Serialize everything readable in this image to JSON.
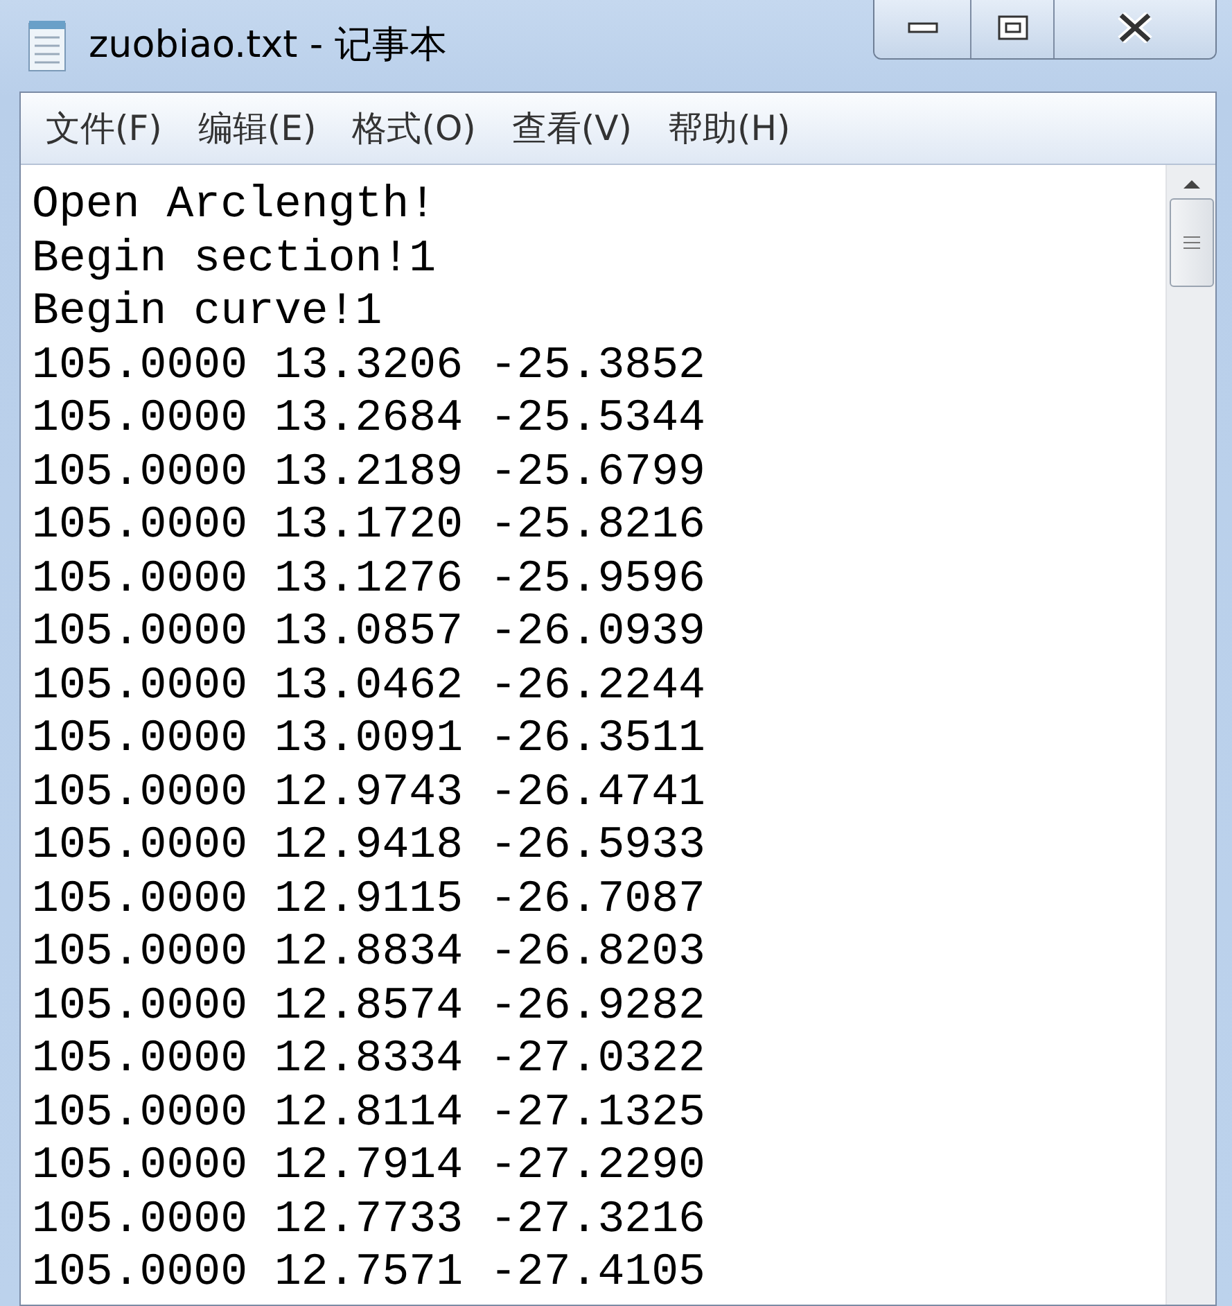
{
  "window": {
    "title": "zuobiao.txt - 记事本"
  },
  "menu": [
    {
      "label": "文件(F)"
    },
    {
      "label": "编辑(E)"
    },
    {
      "label": "格式(O)"
    },
    {
      "label": "查看(V)"
    },
    {
      "label": "帮助(H)"
    }
  ],
  "document": {
    "lines": [
      "Open Arclength!",
      "Begin section!1",
      "Begin curve!1",
      "105.0000 13.3206 -25.3852",
      "105.0000 13.2684 -25.5344",
      "105.0000 13.2189 -25.6799",
      "105.0000 13.1720 -25.8216",
      "105.0000 13.1276 -25.9596",
      "105.0000 13.0857 -26.0939",
      "105.0000 13.0462 -26.2244",
      "105.0000 13.0091 -26.3511",
      "105.0000 12.9743 -26.4741",
      "105.0000 12.9418 -26.5933",
      "105.0000 12.9115 -26.7087",
      "105.0000 12.8834 -26.8203",
      "105.0000 12.8574 -26.9282",
      "105.0000 12.8334 -27.0322",
      "105.0000 12.8114 -27.1325",
      "105.0000 12.7914 -27.2290",
      "105.0000 12.7733 -27.3216",
      "105.0000 12.7571 -27.4105"
    ]
  }
}
